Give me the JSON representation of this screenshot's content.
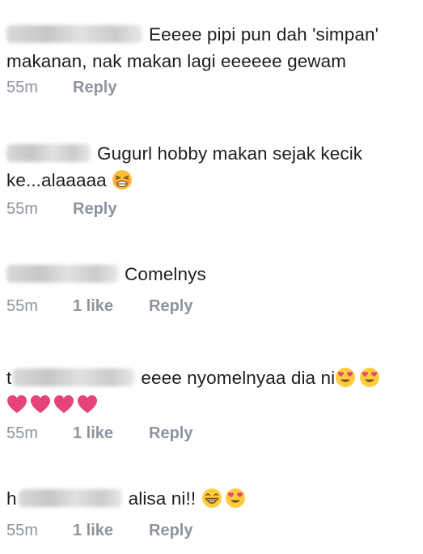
{
  "comments": [
    {
      "text_line1": "Eeeee pipi pun dah 'simpan'",
      "text_line2": "makanan, nak makan lagi eeeeee gewam",
      "time": "55m",
      "reply": "Reply"
    },
    {
      "text_line1": "Gugurl hobby makan sejak kecik",
      "text_line2": "ke...alaaaaa",
      "time": "55m",
      "reply": "Reply"
    },
    {
      "text": "Comelnys",
      "time": "55m",
      "likes": "1 like",
      "reply": "Reply"
    },
    {
      "name_initial": "t",
      "text": "eeee nyomelnyaa dia ni",
      "time": "55m",
      "likes": "1 like",
      "reply": "Reply"
    },
    {
      "name_initial": "h",
      "text": "alisa ni!!",
      "time": "55m",
      "likes": "1 like",
      "reply": "Reply"
    }
  ],
  "icons": {
    "angry_face": "persevering-face-emoji",
    "heart_eyes": "smiling-face-with-heart-eyes-emoji",
    "grin": "grinning-face-emoji",
    "heart": "pink-heart-emoji"
  },
  "colors": {
    "text": "#1c1e21",
    "meta": "#8d949e",
    "emoji_yellow": "#ffcc3e",
    "heart_pink": "#e5447b"
  }
}
